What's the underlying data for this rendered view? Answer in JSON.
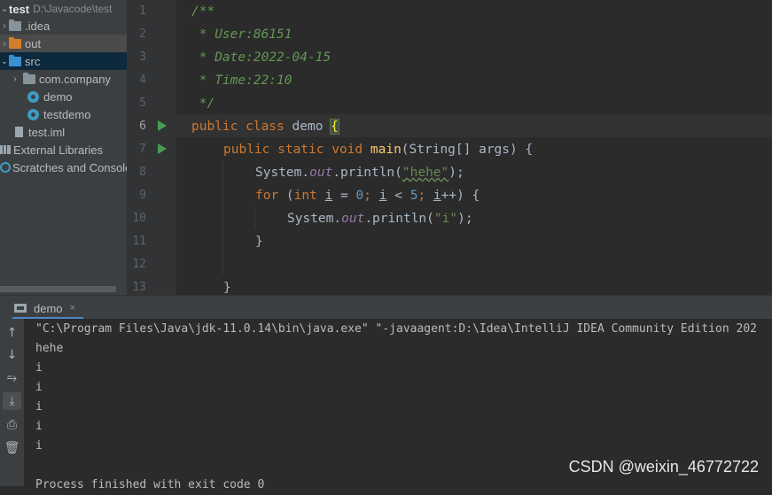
{
  "project_tree": {
    "root": {
      "name": "test",
      "path": "D:\\Javacode\\test"
    },
    "items": [
      {
        "label": ".idea"
      },
      {
        "label": "out"
      },
      {
        "label": "src"
      },
      {
        "label": "com.company"
      },
      {
        "label": "demo"
      },
      {
        "label": "testdemo"
      },
      {
        "label": "test.iml"
      },
      {
        "label": "External Libraries"
      },
      {
        "label": "Scratches and Consoles"
      }
    ]
  },
  "editor": {
    "line_numbers": [
      "1",
      "2",
      "3",
      "4",
      "5",
      "6",
      "7",
      "8",
      "9",
      "10",
      "11",
      "12",
      "13"
    ],
    "code": {
      "l1": "/**",
      "l2": " * User:86151",
      "l3": " * Date:2022-04-15",
      "l4": " * Time:22:10",
      "l5": " */",
      "l6_kw": "public class",
      "l6_name": "demo",
      "l6_brace": "{",
      "l7_kw": "public static void",
      "l7_fn": "main",
      "l7_rest": "(String[] args) {",
      "l8_a": "System.",
      "l8_out": "out",
      "l8_b": ".println(",
      "l8_str": "\"hehe\"",
      "l8_c": ");",
      "l9_for": "for",
      "l9_a": " (",
      "l9_int": "int",
      "l9_i1": "i",
      "l9_b": " = ",
      "l9_n0": "0",
      "l9_semi1": "; ",
      "l9_i2": "i",
      "l9_c": " < ",
      "l9_n5": "5",
      "l9_semi2": "; ",
      "l9_i3": "i",
      "l9_d": "++) {",
      "l10_a": "System.",
      "l10_out": "out",
      "l10_b": ".println(",
      "l10_str": "\"i\"",
      "l10_c": ");",
      "l11": "}",
      "l13": "}"
    }
  },
  "run_window": {
    "tab_label": "demo",
    "tab_close": "×",
    "console_lines": [
      "\"C:\\Program Files\\Java\\jdk-11.0.14\\bin\\java.exe\" \"-javaagent:D:\\Idea\\IntelliJ IDEA Community Edition 202",
      "hehe",
      "i",
      "i",
      "i",
      "i",
      "i",
      "",
      "Process finished with exit code 0"
    ],
    "tools": [
      "arrow-up-icon",
      "arrow-down-icon",
      "soft-wrap-icon",
      "scroll-to-end-icon",
      "print-icon",
      "trash-icon"
    ]
  },
  "watermark": "CSDN @weixin_46772722",
  "colors": {
    "keyword": "#cc7832",
    "string": "#6a8759",
    "comment": "#629755",
    "number": "#6897bb",
    "field": "#9876aa",
    "method": "#ffc66d",
    "run": "#499c54"
  }
}
